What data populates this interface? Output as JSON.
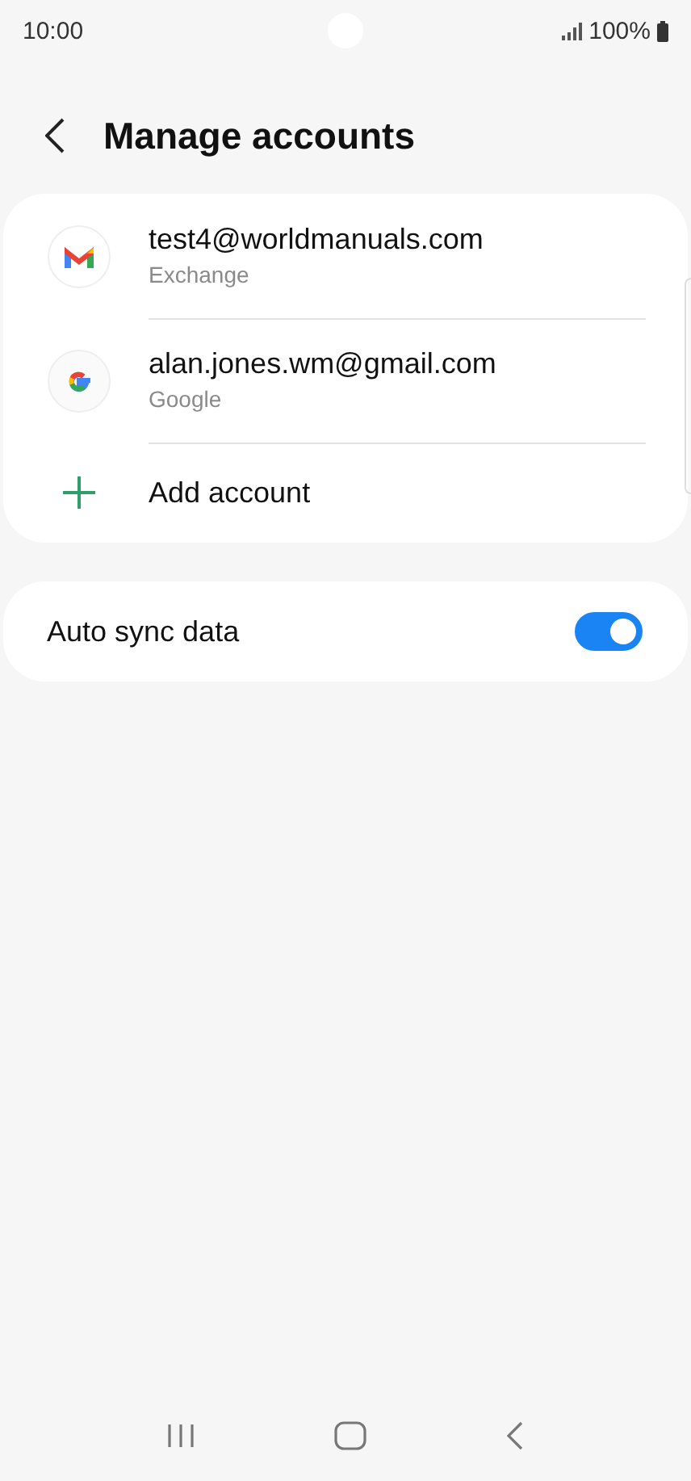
{
  "status_bar": {
    "time": "10:00",
    "battery": "100%"
  },
  "header": {
    "title": "Manage accounts"
  },
  "accounts": [
    {
      "kind": "gmail",
      "name": "test4@worldmanuals.com",
      "type": "Exchange"
    },
    {
      "kind": "google",
      "name": "alan.jones.wm@gmail.com",
      "type": "Google"
    },
    {
      "kind": "add",
      "name": "Add account"
    }
  ],
  "auto_sync": {
    "label": "Auto sync data",
    "on": true
  }
}
